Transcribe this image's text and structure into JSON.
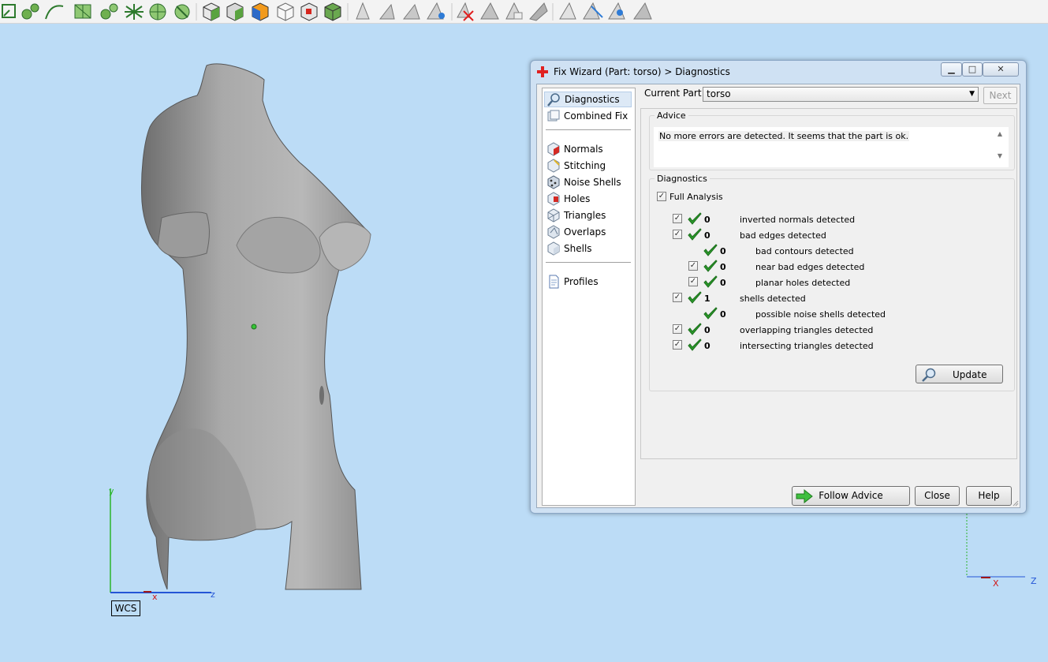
{
  "toolbar": {
    "icons": [
      "select-icon",
      "grab-icon",
      "curve-icon",
      "mesh-select-icon",
      "surface-select-icon",
      "shell-select-icon",
      "wheel-select-icon",
      "wheel-select-2-icon",
      "box-view-icon",
      "box-shaded-icon",
      "box-color-icon",
      "box-wire-icon",
      "box-red-icon",
      "box-green-icon",
      "triangle-icon",
      "triangle-2-icon",
      "triangle-3-icon",
      "triangle-blue-icon",
      "triangle-delete-icon",
      "triangle-4-icon",
      "triangle-5-icon",
      "triangle-6-icon",
      "cone-icon",
      "cone-blue-icon",
      "cone-eye-icon",
      "cone-grey-icon"
    ]
  },
  "viewport": {
    "axes": {
      "y": "y",
      "x": "x",
      "z": "z",
      "x2": "X",
      "z2": "Z"
    },
    "wcs": "WCS"
  },
  "dialog": {
    "title": "Fix Wizard (Part: torso) > Diagnostics",
    "current_part_label": "Current Part:",
    "current_part_value": "torso",
    "next_label": "Next",
    "nav": [
      {
        "label": "Diagnostics",
        "icon": "magnifier-icon"
      },
      {
        "label": "Combined Fix",
        "icon": "combined-fix-icon"
      },
      {
        "label": "Normals",
        "icon": "normals-icon"
      },
      {
        "label": "Stitching",
        "icon": "stitching-icon"
      },
      {
        "label": "Noise Shells",
        "icon": "noise-shells-icon"
      },
      {
        "label": "Holes",
        "icon": "holes-icon"
      },
      {
        "label": "Triangles",
        "icon": "triangles-icon"
      },
      {
        "label": "Overlaps",
        "icon": "overlaps-icon"
      },
      {
        "label": "Shells",
        "icon": "shells-icon"
      },
      {
        "label": "Profiles",
        "icon": "profiles-icon"
      }
    ],
    "advice": {
      "legend": "Advice",
      "text": "No more errors are detected. It seems that the part is ok."
    },
    "diagnostics": {
      "legend": "Diagnostics",
      "full_analysis_label": "Full Analysis",
      "rows": [
        {
          "checkbox": true,
          "count": "0",
          "label": "inverted normals detected",
          "indent": 0
        },
        {
          "checkbox": true,
          "count": "0",
          "label": "bad edges detected",
          "indent": 0
        },
        {
          "checkbox": false,
          "count": "0",
          "label": "bad contours detected",
          "indent": 1
        },
        {
          "checkbox": true,
          "count": "0",
          "label": "near bad edges detected",
          "indent": 1
        },
        {
          "checkbox": true,
          "count": "0",
          "label": "planar holes detected",
          "indent": 1
        },
        {
          "checkbox": true,
          "count": "1",
          "label": "shells detected",
          "indent": 0
        },
        {
          "checkbox": false,
          "count": "0",
          "label": "possible noise shells detected",
          "indent": 1
        },
        {
          "checkbox": true,
          "count": "0",
          "label": "overlapping triangles detected",
          "indent": 0
        },
        {
          "checkbox": true,
          "count": "0",
          "label": "intersecting triangles detected",
          "indent": 0
        }
      ],
      "update_label": "Update"
    },
    "buttons": {
      "follow_advice": "Follow Advice",
      "close": "Close",
      "help": "Help"
    }
  }
}
